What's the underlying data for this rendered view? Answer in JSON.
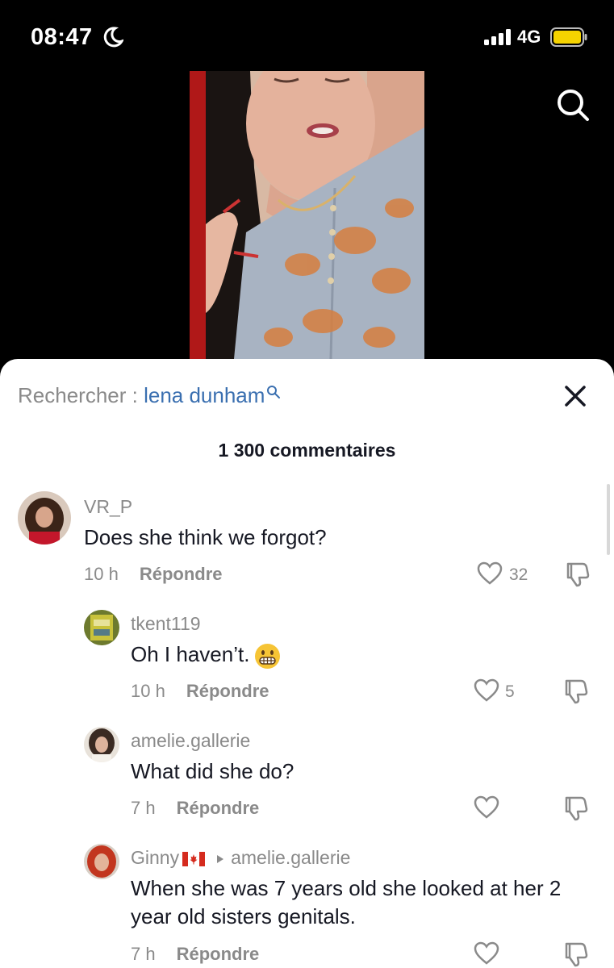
{
  "status_bar": {
    "time": "08:47",
    "network": "4G",
    "icons": [
      "moon-icon",
      "signal-icon",
      "battery-icon"
    ]
  },
  "video": {
    "icons": [
      "search-icon"
    ]
  },
  "comments_panel": {
    "search_prefix": "Rechercher : ",
    "search_term": "lena dunham",
    "comment_count": "1 300 commentaires",
    "comments": [
      {
        "username": "VR_P",
        "text": "Does she think we forgot?",
        "time": "10 h",
        "reply_label": "Répondre",
        "likes": "32"
      },
      {
        "username": "tkent119",
        "text": "Oh I haven’t.",
        "emoji": "grimacing-face",
        "time": "10 h",
        "reply_label": "Répondre",
        "likes": "5"
      },
      {
        "username": "amelie.gallerie",
        "text": "What did she do?",
        "time": "7 h",
        "reply_label": "Répondre",
        "likes": ""
      },
      {
        "username": "Ginny",
        "flag": "canada-flag",
        "reply_to": "amelie.gallerie",
        "text": "When she was 7 years old she looked at her 2 year old sisters genitals.",
        "time": "7 h",
        "reply_label": "Répondre",
        "likes": ""
      }
    ]
  },
  "colors": {
    "search_term": "#3a6fb0",
    "secondary_text": "#8a8a8a",
    "primary_text": "#161823",
    "battery": "#f5d300"
  }
}
